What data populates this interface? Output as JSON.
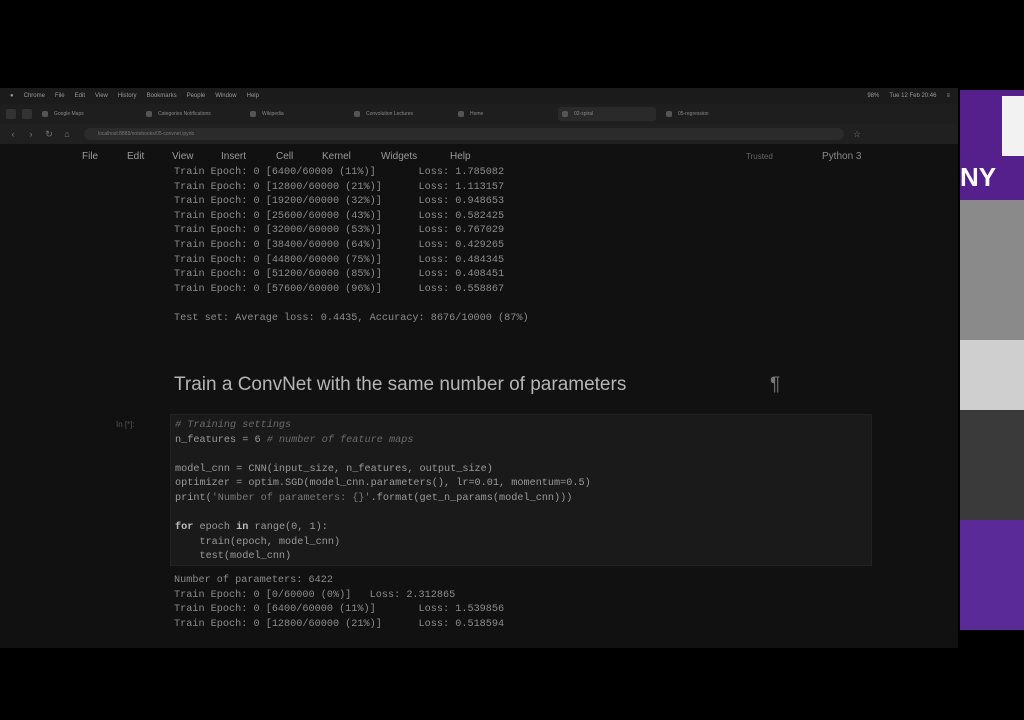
{
  "mac_menu": [
    "Chrome",
    "File",
    "Edit",
    "View",
    "History",
    "Bookmarks",
    "People",
    "Window",
    "Help"
  ],
  "mac_status": [
    "98%",
    "Tue 12 Feb 20:46"
  ],
  "browser_tabs": [
    "Google Maps",
    "Categories Notifications",
    "Wikipedia",
    "Convolution Lectures",
    "Home",
    "02-spiral",
    "05-regression"
  ],
  "address": "localhost:8888/notebooks/05-convnet.ipynb",
  "jupyter_menu": [
    "File",
    "Edit",
    "View",
    "Insert",
    "Cell",
    "Kernel",
    "Widgets",
    "Help"
  ],
  "trusted_label": "Trusted",
  "kernel_label": "Python 3",
  "output_top": [
    "Train Epoch: 0 [6400/60000 (11%)]\tLoss: 1.785082",
    "Train Epoch: 0 [12800/60000 (21%)]\tLoss: 1.113157",
    "Train Epoch: 0 [19200/60000 (32%)]\tLoss: 0.948653",
    "Train Epoch: 0 [25600/60000 (43%)]\tLoss: 0.582425",
    "Train Epoch: 0 [32000/60000 (53%)]\tLoss: 0.767029",
    "Train Epoch: 0 [38400/60000 (64%)]\tLoss: 0.429265",
    "Train Epoch: 0 [44800/60000 (75%)]\tLoss: 0.484345",
    "Train Epoch: 0 [51200/60000 (85%)]\tLoss: 0.408451",
    "Train Epoch: 0 [57600/60000 (96%)]\tLoss: 0.558867",
    "",
    "Test set: Average loss: 0.4435, Accuracy: 8676/10000 (87%)"
  ],
  "heading": "Train a ConvNet with the same number of parameters",
  "pilcrow": "¶",
  "cell_prompt": "In [*]:",
  "code": {
    "l1": "# Training settings",
    "l2a": "n_features = 6 ",
    "l2b": "# number of feature maps",
    "l3": "model_cnn = CNN(input_size, n_features, output_size)",
    "l4": "optimizer = optim.SGD(model_cnn.parameters(), lr=0.01, momentum=0.5)",
    "l5a": "print(",
    "l5b": "'Number of parameters: {}'",
    "l5c": ".format(get_n_params(model_cnn)))",
    "l6a": "for",
    "l6b": " epoch ",
    "l6c": "in",
    "l6d": " range(0, 1):",
    "l7": "    train(epoch, model_cnn)",
    "l8": "    test(model_cnn)"
  },
  "output_bottom": [
    "Number of parameters: 6422",
    "Train Epoch: 0 [0/60000 (0%)]\tLoss: 2.312865",
    "Train Epoch: 0 [6400/60000 (11%)]\tLoss: 1.539856",
    "Train Epoch: 0 [12800/60000 (21%)]\tLoss: 0.518594"
  ],
  "side_logo": "NY",
  "colors": {
    "nyu_purple": "#56208c",
    "background": "#111111"
  }
}
